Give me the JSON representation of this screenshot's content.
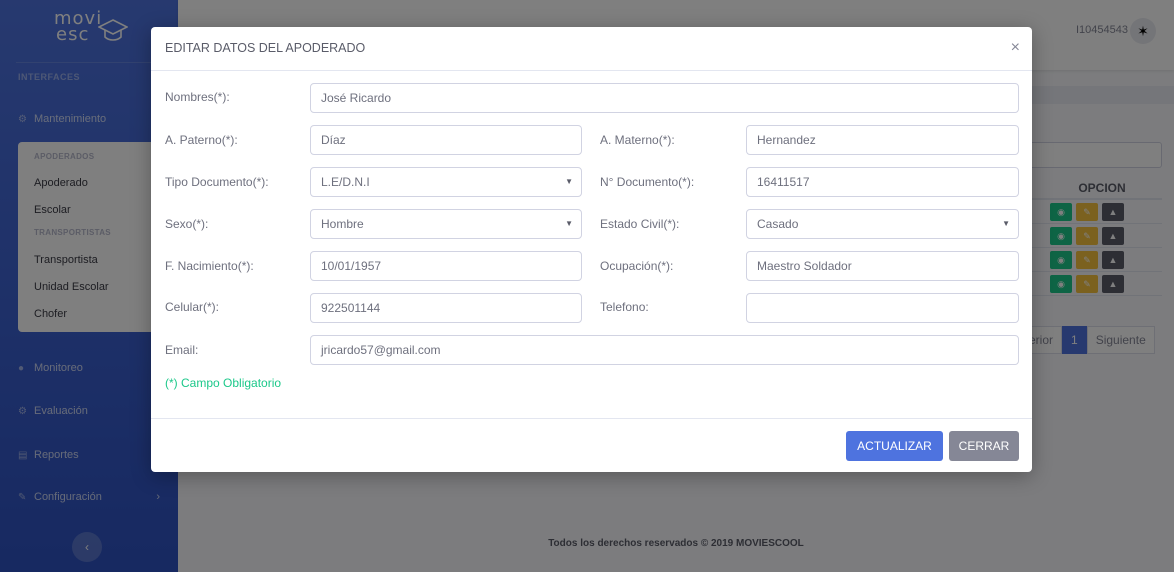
{
  "sidebar": {
    "logo_line1": "movi",
    "logo_line2": "esc",
    "section_interfaces": "INTERFACES",
    "mantenimiento": "Mantenimiento",
    "sub_heading_apoderados": "APODERADOS",
    "sub_apoderado": "Apoderado",
    "sub_escolar": "Escolar",
    "sub_heading_transportistas": "TRANSPORTISTAS",
    "sub_transportista": "Transportista",
    "sub_unidad": "Unidad Escolar",
    "sub_chofer": "Chofer",
    "monitoreo": "Monitoreo",
    "evaluacion": "Evaluación",
    "reportes": "Reportes",
    "configuracion": "Configuración"
  },
  "topbar": {
    "user_id": "I10454543"
  },
  "table": {
    "header_opcion": "OPCION",
    "pager_prev": "erior",
    "pager_page": "1",
    "pager_next": "Siguiente"
  },
  "footer": {
    "text": "Todos los derechos reservados © 2019 MOVIESCOOL"
  },
  "modal": {
    "title": "EDITAR DATOS DEL APODERADO",
    "close_symbol": "×",
    "fields": {
      "nombres_label": "Nombres(*):",
      "nombres_value": "José Ricardo",
      "paterno_label": "A. Paterno(*):",
      "paterno_value": "Díaz",
      "materno_label": "A. Materno(*):",
      "materno_value": "Hernandez",
      "tipodoc_label": "Tipo Documento(*):",
      "tipodoc_value": "L.E/D.N.I",
      "nrodoc_label": "N° Documento(*):",
      "nrodoc_value": "16411517",
      "sexo_label": "Sexo(*):",
      "sexo_value": "Hombre",
      "estado_label": "Estado Civil(*):",
      "estado_value": "Casado",
      "nacimiento_label": "F. Nacimiento(*):",
      "nacimiento_value": "10/01/1957",
      "ocupacion_label": "Ocupación(*):",
      "ocupacion_value": "Maestro Soldador",
      "celular_label": "Celular(*):",
      "celular_value": "922501144",
      "telefono_label": "Telefono:",
      "telefono_value": "",
      "email_label": "Email:",
      "email_value": "jricardo57@gmail.com"
    },
    "required_note": "(*) Campo Obligatorio",
    "btn_update": "ACTUALIZAR",
    "btn_close": "CERRAR"
  },
  "colors": {
    "primary": "#4e73df",
    "secondary": "#858796",
    "success": "#1cc88a",
    "warning": "#f6c23e"
  }
}
